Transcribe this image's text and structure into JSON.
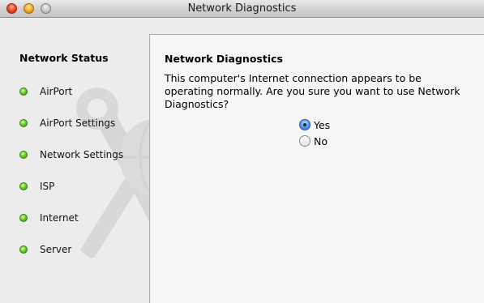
{
  "window": {
    "title": "Network Diagnostics"
  },
  "sidebar": {
    "heading": "Network Status",
    "items": [
      {
        "label": "AirPort",
        "status": "ok",
        "color": "#5cc72a"
      },
      {
        "label": "AirPort Settings",
        "status": "ok",
        "color": "#5cc72a"
      },
      {
        "label": "Network Settings",
        "status": "ok",
        "color": "#5cc72a"
      },
      {
        "label": "ISP",
        "status": "ok",
        "color": "#5cc72a"
      },
      {
        "label": "Internet",
        "status": "ok",
        "color": "#5cc72a"
      },
      {
        "label": "Server",
        "status": "ok",
        "color": "#5cc72a"
      }
    ],
    "watermark_icon": "network-tools-icon"
  },
  "main": {
    "title": "Network Diagnostics",
    "message": "This computer's Internet connection appears to be operating normally. Are you sure you want to use Network Diagnostics?",
    "options": [
      {
        "label": "Yes",
        "selected": true
      },
      {
        "label": "No",
        "selected": false
      }
    ]
  }
}
